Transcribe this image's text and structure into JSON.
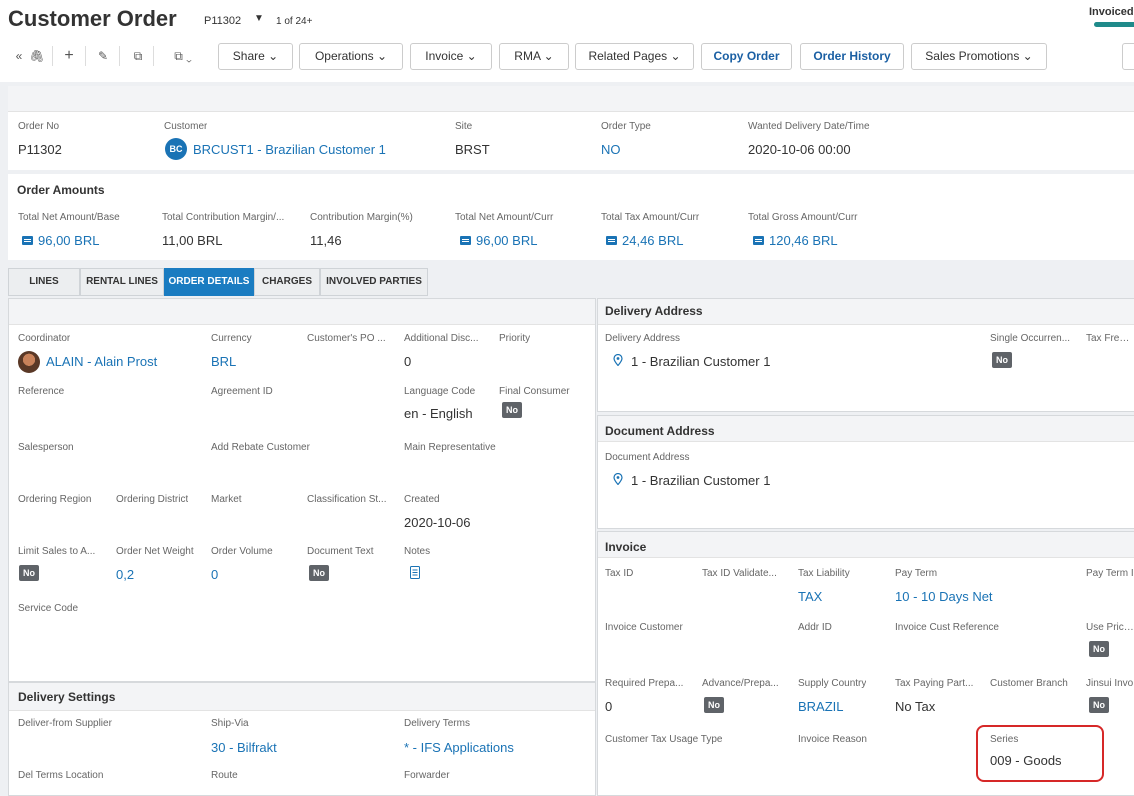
{
  "header": {
    "title": "Customer Order",
    "order_id": "P11302",
    "record_count": "1 of 24+",
    "status": "Invoiced"
  },
  "toolbar": {
    "share": "Share",
    "operations": "Operations",
    "invoice": "Invoice",
    "rma": "RMA",
    "related_pages": "Related Pages",
    "copy_order": "Copy Order",
    "order_history": "Order History",
    "sales_promotions": "Sales Promotions"
  },
  "keys": {
    "order_no_label": "Order No",
    "order_no": "P11302",
    "customer_label": "Customer",
    "customer_initials": "BC",
    "customer": "BRCUST1 - Brazilian Customer 1",
    "site_label": "Site",
    "site": "BRST",
    "order_type_label": "Order Type",
    "order_type": "NO",
    "wanted_label": "Wanted Delivery Date/Time",
    "wanted": "2020-10-06 00:00"
  },
  "amounts": {
    "title": "Order Amounts",
    "net_base_label": "Total Net Amount/Base",
    "net_base": "96,00 BRL",
    "contrib_label": "Total Contribution Margin/...",
    "contrib": "11,00 BRL",
    "contrib_pct_label": "Contribution Margin(%)",
    "contrib_pct": "11,46",
    "net_curr_label": "Total Net Amount/Curr",
    "net_curr": "96,00 BRL",
    "tax_curr_label": "Total Tax Amount/Curr",
    "tax_curr": "24,46 BRL",
    "gross_curr_label": "Total Gross Amount/Curr",
    "gross_curr": "120,46 BRL"
  },
  "tabs": [
    "LINES",
    "RENTAL LINES",
    "ORDER DETAILS",
    "CHARGES",
    "INVOLVED PARTIES"
  ],
  "details": {
    "coordinator_label": "Coordinator",
    "coordinator": "ALAIN - Alain Prost",
    "currency_label": "Currency",
    "currency": "BRL",
    "po_label": "Customer's PO ...",
    "add_disc_label": "Additional Disc...",
    "add_disc": "0",
    "priority_label": "Priority",
    "reference_label": "Reference",
    "agreement_label": "Agreement ID",
    "language_label": "Language Code",
    "language": "en - English",
    "final_consumer_label": "Final Consumer",
    "final_consumer": "No",
    "salesperson_label": "Salesperson",
    "rebate_label": "Add Rebate Customer",
    "main_rep_label": "Main Representative",
    "region_label": "Ordering Region",
    "district_label": "Ordering District",
    "market_label": "Market",
    "classification_label": "Classification St...",
    "created_label": "Created",
    "created": "2020-10-06",
    "limit_label": "Limit Sales to A...",
    "limit": "No",
    "net_weight_label": "Order Net Weight",
    "net_weight": "0,2",
    "volume_label": "Order Volume",
    "volume": "0",
    "doc_text_label": "Document Text",
    "doc_text": "No",
    "notes_label": "Notes",
    "service_code_label": "Service Code"
  },
  "delivery_settings": {
    "title": "Delivery Settings",
    "supplier_label": "Deliver-from Supplier",
    "ship_via_label": "Ship-Via",
    "ship_via": "30 - Bilfrakt",
    "terms_label": "Delivery Terms",
    "terms": "* - IFS Applications",
    "terms_location_label": "Del Terms Location",
    "route_label": "Route",
    "forwarder_label": "Forwarder"
  },
  "delivery_address": {
    "title": "Delivery Address",
    "label": "Delivery Address",
    "value": "1 - Brazilian Customer 1",
    "single_label": "Single Occurren...",
    "single": "No",
    "tax_free_label": "Tax Free C"
  },
  "document_address": {
    "title": "Document Address",
    "label": "Document Address",
    "value": "1 - Brazilian Customer 1"
  },
  "invoice": {
    "title": "Invoice",
    "tax_id_label": "Tax ID",
    "tax_id_valid_label": "Tax ID Validate...",
    "tax_liability_label": "Tax Liability",
    "tax_liability": "TAX",
    "pay_term_label": "Pay Term",
    "pay_term": "10 - 10 Days Net",
    "pay_term2_label": "Pay Term I",
    "invoice_customer_label": "Invoice Customer",
    "addr_id_label": "Addr ID",
    "cust_ref_label": "Invoice Cust Reference",
    "use_price_label": "Use Price I",
    "use_price": "No",
    "req_prepay_label": "Required Prepa...",
    "req_prepay": "0",
    "adv_prepay_label": "Advance/Prepa...",
    "adv_prepay": "No",
    "supply_country_label": "Supply Country",
    "supply_country": "BRAZIL",
    "tax_paying_label": "Tax Paying Part...",
    "tax_paying": "No Tax",
    "branch_label": "Customer Branch",
    "jinsui_label": "Jinsui Invo",
    "jinsui": "No",
    "usage_type_label": "Customer Tax Usage Type",
    "reason_label": "Invoice Reason",
    "series_label": "Series",
    "series": "009 - Goods"
  },
  "colors": {
    "accent": "#1a73b5",
    "tab_active": "#1a7cc1",
    "highlight": "#d62828",
    "status_bar": "#1f8a8a"
  }
}
